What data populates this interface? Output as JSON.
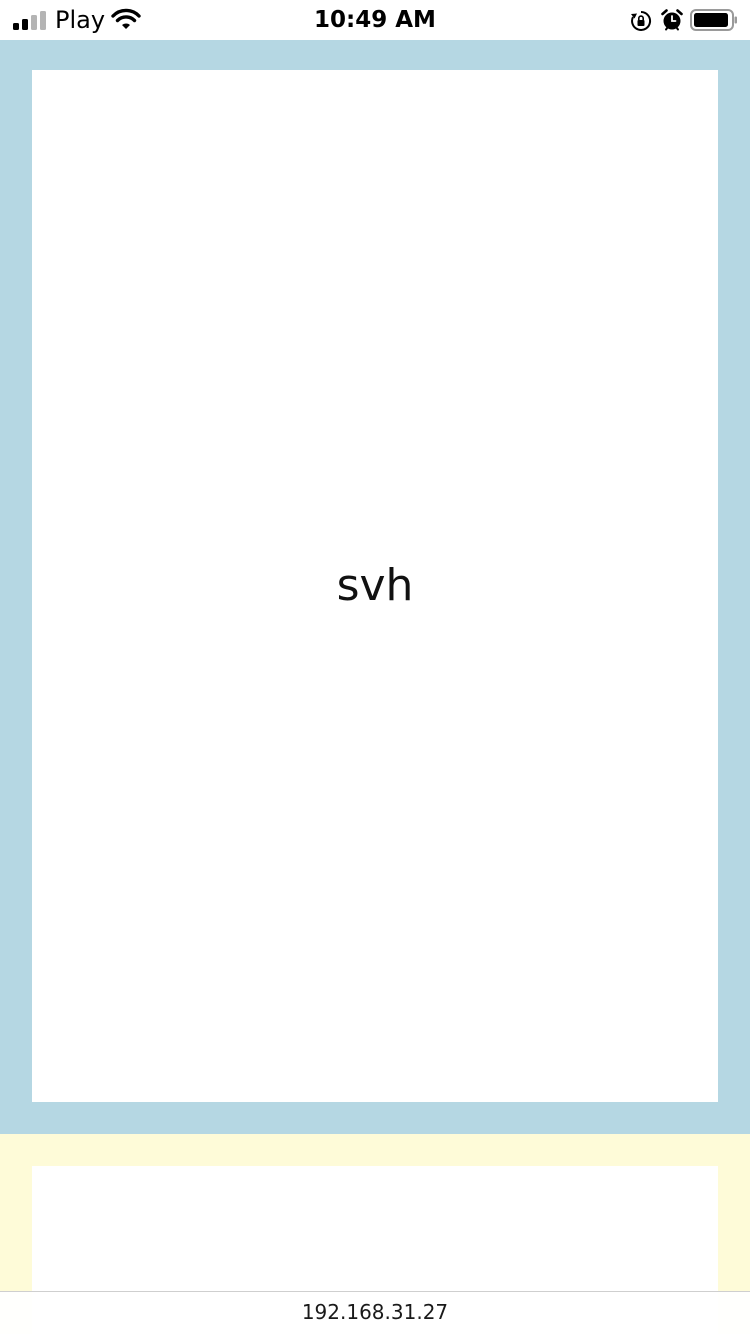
{
  "status_bar": {
    "carrier": "Play",
    "time": "10:49 AM",
    "signal_bars_filled": 2,
    "signal_bars_total": 4,
    "icons": [
      "signal-icon",
      "wifi-icon",
      "rotation-lock-icon",
      "alarm-icon",
      "battery-icon"
    ]
  },
  "content": {
    "first_block_label": "svh",
    "first_block_color": "#b5d7e3",
    "second_block_color": "#fefbd8"
  },
  "url_bar": {
    "address": "192.168.31.27"
  }
}
